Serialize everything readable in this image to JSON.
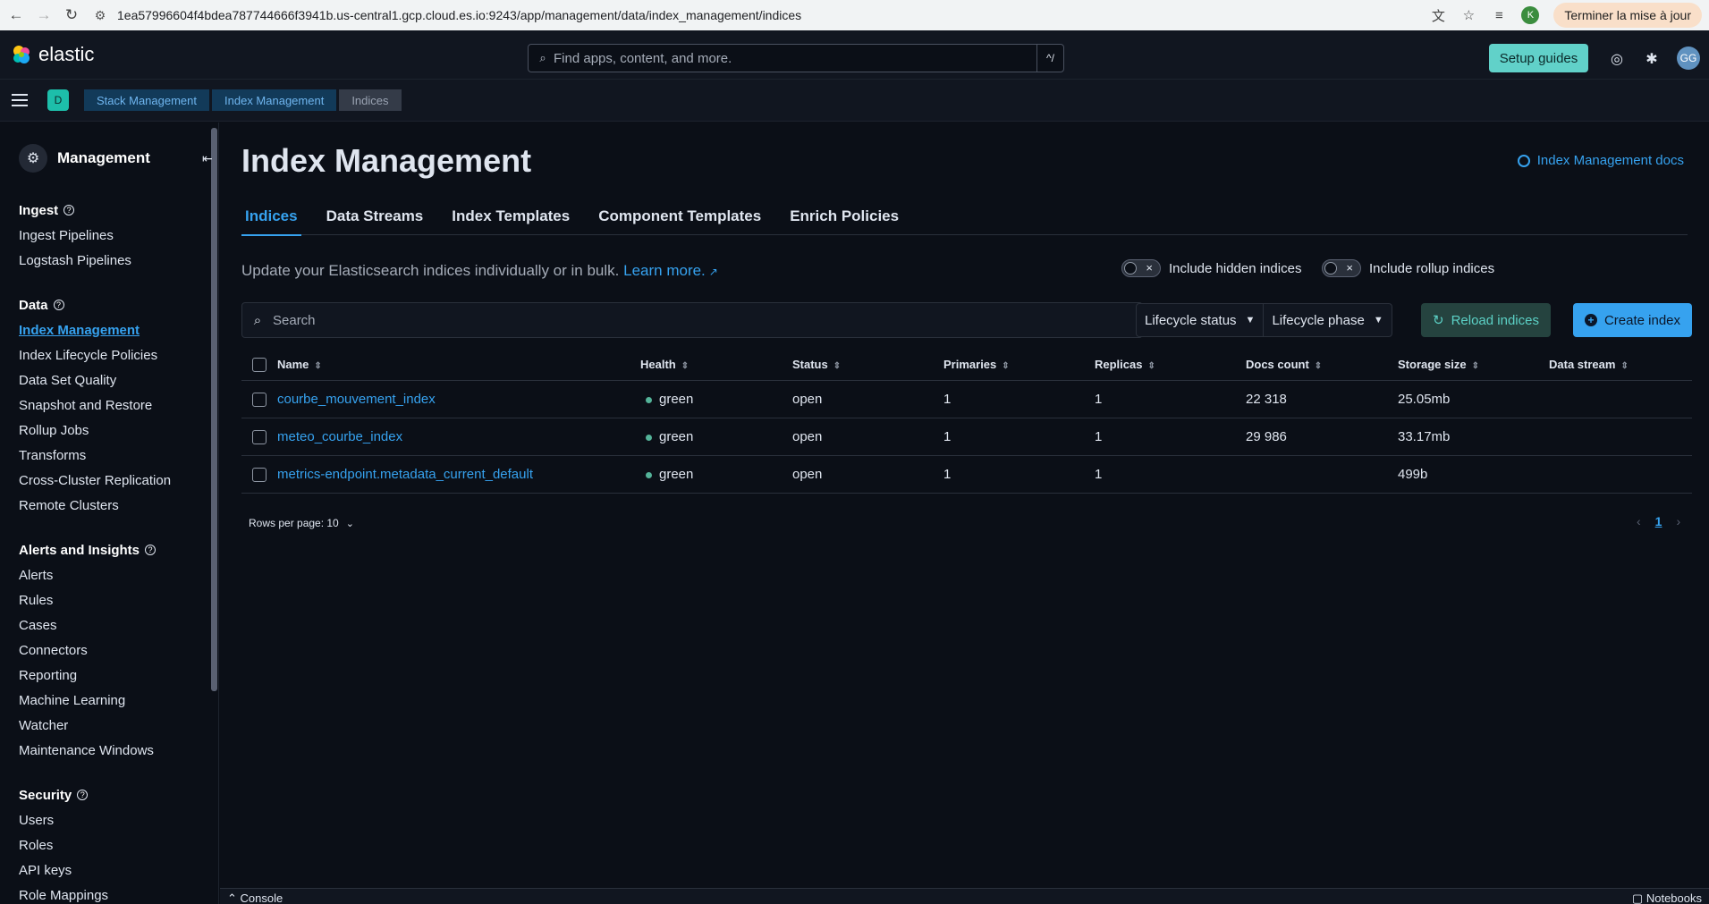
{
  "browser": {
    "url": "1ea57996604f4bdea787744666f3941b.us-central1.gcp.cloud.es.io:9243/app/management/data/index_management/indices",
    "profile_initial": "K",
    "update_label": "Terminer la mise à jour"
  },
  "header": {
    "logo_text": "elastic",
    "search_placeholder": "Find apps, content, and more.",
    "search_shortcut": "^/",
    "setup_guides_label": "Setup guides",
    "avatar_initials": "GG"
  },
  "breadcrumbs": {
    "space_initial": "D",
    "items": [
      "Stack Management",
      "Index Management",
      "Indices"
    ]
  },
  "sidebar": {
    "title": "Management",
    "sections": [
      {
        "title": "Ingest",
        "items": [
          "Ingest Pipelines",
          "Logstash Pipelines"
        ]
      },
      {
        "title": "Data",
        "items": [
          "Index Management",
          "Index Lifecycle Policies",
          "Data Set Quality",
          "Snapshot and Restore",
          "Rollup Jobs",
          "Transforms",
          "Cross-Cluster Replication",
          "Remote Clusters"
        ]
      },
      {
        "title": "Alerts and Insights",
        "items": [
          "Alerts",
          "Rules",
          "Cases",
          "Connectors",
          "Reporting",
          "Machine Learning",
          "Watcher",
          "Maintenance Windows"
        ]
      },
      {
        "title": "Security",
        "items": [
          "Users",
          "Roles",
          "API keys",
          "Role Mappings"
        ]
      }
    ],
    "active_item": "Index Management"
  },
  "main": {
    "title": "Index Management",
    "docs_link": "Index Management docs",
    "tabs": [
      "Indices",
      "Data Streams",
      "Index Templates",
      "Component Templates",
      "Enrich Policies"
    ],
    "active_tab": "Indices",
    "description": "Update your Elasticsearch indices individually or in bulk.",
    "learn_more": "Learn more.",
    "toggle_hidden": "Include hidden indices",
    "toggle_rollup": "Include rollup indices",
    "search_placeholder": "Search",
    "filter_lifecycle_status": "Lifecycle status",
    "filter_lifecycle_phase": "Lifecycle phase",
    "reload_label": "Reload indices",
    "create_label": "Create index",
    "columns": [
      "Name",
      "Health",
      "Status",
      "Primaries",
      "Replicas",
      "Docs count",
      "Storage size",
      "Data stream"
    ],
    "rows": [
      {
        "name": "courbe_mouvement_index",
        "health": "green",
        "status": "open",
        "primaries": "1",
        "replicas": "1",
        "docs_count": "22 318",
        "storage_size": "25.05mb",
        "data_stream": ""
      },
      {
        "name": "meteo_courbe_index",
        "health": "green",
        "status": "open",
        "primaries": "1",
        "replicas": "1",
        "docs_count": "29 986",
        "storage_size": "33.17mb",
        "data_stream": ""
      },
      {
        "name": "metrics-endpoint.metadata_current_default",
        "health": "green",
        "status": "open",
        "primaries": "1",
        "replicas": "1",
        "docs_count": "",
        "storage_size": "499b",
        "data_stream": ""
      }
    ],
    "rows_per_page": "Rows per page: 10",
    "current_page": "1"
  },
  "footer": {
    "console_label": "Console",
    "notebooks_label": "Notebooks"
  },
  "colors": {
    "accent": "#36a2ef",
    "health_green": "#54b399",
    "setup_btn": "#61d1c9"
  }
}
